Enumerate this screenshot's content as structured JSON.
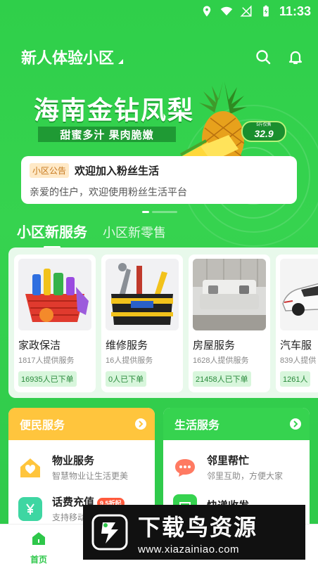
{
  "status_bar": {
    "time": "11:33",
    "icons": [
      "location-icon",
      "wifi-icon",
      "no-signal-icon",
      "battery-charging-icon"
    ]
  },
  "header": {
    "community_name": "新人体验小区",
    "icons": [
      "search-icon",
      "bell-icon"
    ]
  },
  "banner": {
    "title": "海南金钻凤梨",
    "subtitle": "甜蜜多汁 果肉脆嫩",
    "price_label": "5斤仅售",
    "price": "32.9"
  },
  "notice": {
    "badge": "小区公告",
    "title": "欢迎加入粉丝生活",
    "body": "亲爱的住户，欢迎使用粉丝生活平台"
  },
  "tabs": [
    {
      "label": "小区新服务",
      "active": true
    },
    {
      "label": "小区新零售",
      "active": false
    }
  ],
  "services": [
    {
      "name": "家政保洁",
      "providers": "1817人提供服务",
      "orders": "16935人已下单"
    },
    {
      "name": "维修服务",
      "providers": "16人提供服务",
      "orders": "0人已下单"
    },
    {
      "name": "房屋服务",
      "providers": "1628人提供服务",
      "orders": "21458人已下单"
    },
    {
      "name": "汽车服",
      "providers": "839人提供",
      "orders": "1261人"
    }
  ],
  "convenience": {
    "title": "便民服务",
    "items": [
      {
        "title": "物业服务",
        "subtitle": "智慧物业让生活更美"
      },
      {
        "title": "话费充值",
        "subtitle": "支持移动",
        "badge": "9.5折起"
      }
    ]
  },
  "life": {
    "title": "生活服务",
    "items": [
      {
        "title": "邻里帮忙",
        "subtitle": "邻里互助，方便大家"
      },
      {
        "title": "快递收发",
        "subtitle": ""
      }
    ]
  },
  "bottom_nav": {
    "home_label": "首页"
  },
  "watermark": {
    "main": "下载鸟资源",
    "url": "www.xiazainiao.com"
  },
  "colors": {
    "primary_green": "#2ec74a",
    "convenience_yellow": "#ffc53d",
    "notice_badge_bg": "#ffe9c7"
  }
}
